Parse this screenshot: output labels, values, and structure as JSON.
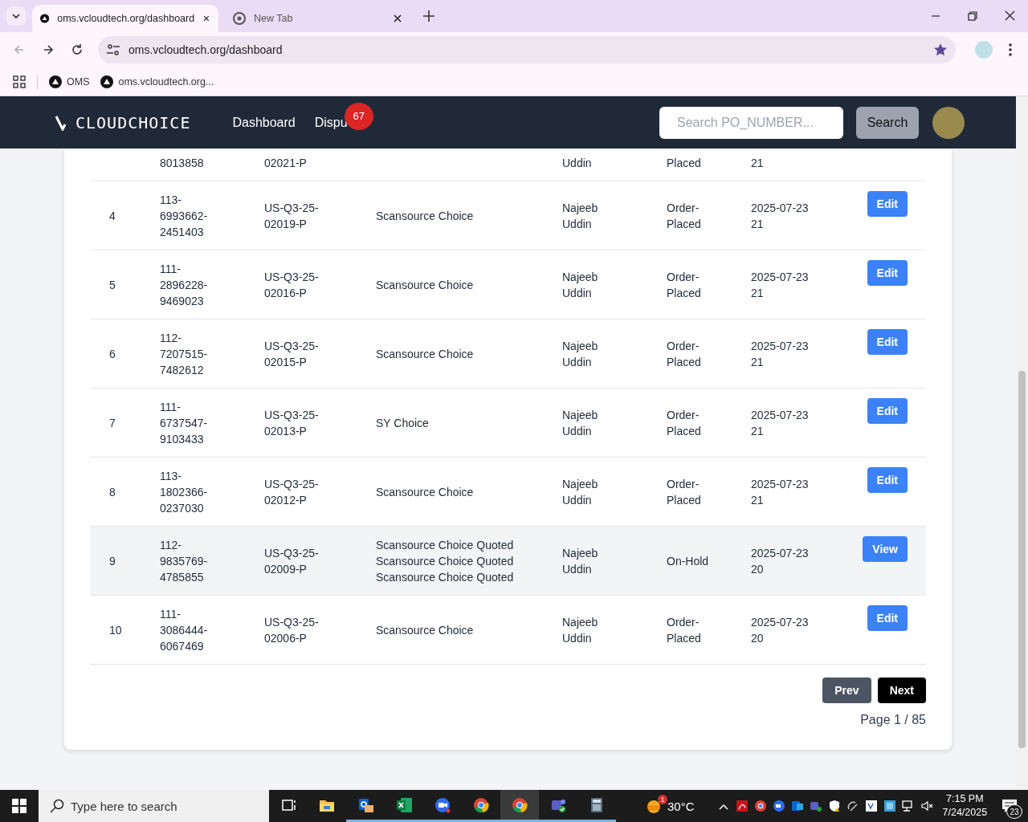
{
  "browser": {
    "tabs": [
      {
        "title": "oms.vcloudtech.org/dashboard",
        "kind": "site",
        "selected": true
      },
      {
        "title": "New Tab",
        "kind": "newtab",
        "selected": false
      }
    ],
    "address": "oms.vcloudtech.org/dashboard",
    "bookmarks": [
      {
        "label": "OMS"
      },
      {
        "label": "oms.vcloudtech.org..."
      }
    ]
  },
  "app": {
    "logo": "CLOUDCHOICE",
    "nav": [
      {
        "label": "Dashboard"
      },
      {
        "label": "Dispu",
        "badge": "67"
      }
    ],
    "search": {
      "placeholder": "Search PO_NUMBER...",
      "button": "Search"
    }
  },
  "table": {
    "partial_row": {
      "column_2": "8013858",
      "column_3": "02021-P",
      "column_5": "Uddin",
      "column_6": "Placed",
      "column_7": "21"
    },
    "rows": [
      {
        "column_1": "4",
        "column_2": "113-6993662-2451403",
        "column_3": "US-Q3-25-02019-P",
        "column_4": "Scansource Choice",
        "column_5": "Najeeb Uddin",
        "column_6": "Order-Placed",
        "column_7": "2025-07-23 21",
        "action": "Edit",
        "highlighted": false
      },
      {
        "column_1": "5",
        "column_2": "111-2896228-9469023",
        "column_3": "US-Q3-25-02016-P",
        "column_4": "Scansource Choice",
        "column_5": "Najeeb Uddin",
        "column_6": "Order-Placed",
        "column_7": "2025-07-23 21",
        "action": "Edit",
        "highlighted": false
      },
      {
        "column_1": "6",
        "column_2": "112-7207515-7482612",
        "column_3": "US-Q3-25-02015-P",
        "column_4": "Scansource Choice",
        "column_5": "Najeeb Uddin",
        "column_6": "Order-Placed",
        "column_7": "2025-07-23 21",
        "action": "Edit",
        "highlighted": false
      },
      {
        "column_1": "7",
        "column_2": "111-6737547-9103433",
        "column_3": "US-Q3-25-02013-P",
        "column_4": "SY Choice",
        "column_5": "Najeeb Uddin",
        "column_6": "Order-Placed",
        "column_7": "2025-07-23 21",
        "action": "Edit",
        "highlighted": false
      },
      {
        "column_1": "8",
        "column_2": "113-1802366-0237030",
        "column_3": "US-Q3-25-02012-P",
        "column_4": "Scansource Choice",
        "column_5": "Najeeb Uddin",
        "column_6": "Order-Placed",
        "column_7": "2025-07-23 21",
        "action": "Edit",
        "highlighted": false
      },
      {
        "column_1": "9",
        "column_2": "112-9835769-4785855",
        "column_3": "US-Q3-25-02009-P",
        "column_4": "Scansource Choice Quoted Scansource Choice Quoted Scansource Choice Quoted",
        "column_5": "Najeeb Uddin",
        "column_6": "On-Hold",
        "column_7": "2025-07-23 20",
        "action": "View",
        "highlighted": true
      },
      {
        "column_1": "10",
        "column_2": "111-3086444-6067469",
        "column_3": "US-Q3-25-02006-P",
        "column_4": "Scansource Choice",
        "column_5": "Najeeb Uddin",
        "column_6": "Order-Placed",
        "column_7": "2025-07-23 20",
        "action": "Edit",
        "highlighted": false
      }
    ]
  },
  "pagination": {
    "prev": "Prev",
    "next": "Next",
    "page_label": "Page 1 / 85"
  },
  "taskbar": {
    "search_placeholder": "Type here to search",
    "apps": [
      {
        "kind": "taskview",
        "running": false,
        "active": false
      },
      {
        "kind": "folder",
        "running": false,
        "active": false
      },
      {
        "kind": "mail",
        "running": true,
        "active": false
      },
      {
        "kind": "sheet",
        "running": true,
        "active": false
      },
      {
        "kind": "video",
        "running": true,
        "active": false
      },
      {
        "kind": "browser",
        "running": true,
        "active": false
      },
      {
        "kind": "browser",
        "running": true,
        "active": true
      },
      {
        "kind": "team",
        "running": true,
        "active": false
      },
      {
        "kind": "calculator",
        "running": true,
        "active": false
      }
    ],
    "weather_alert": "1",
    "weather": "30°C",
    "time": "7:15 PM",
    "date": "7/24/2025",
    "notifications": "23"
  }
}
